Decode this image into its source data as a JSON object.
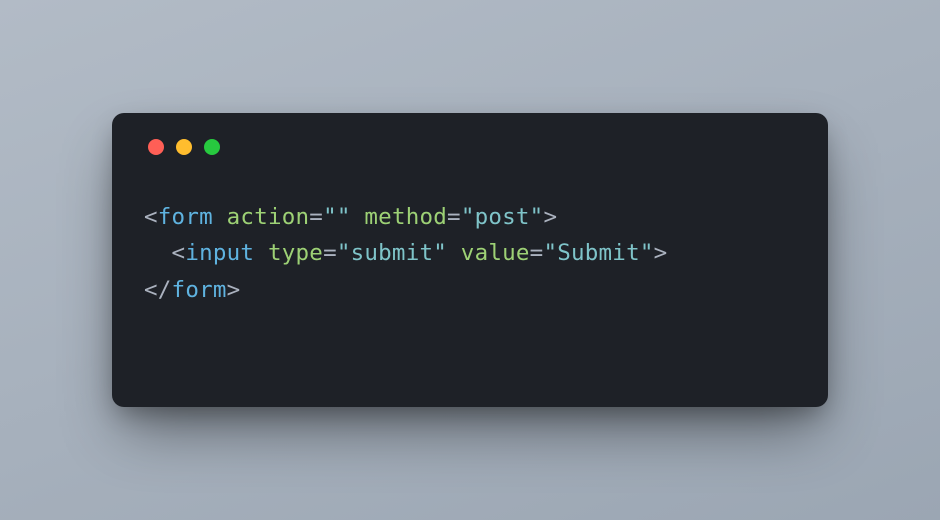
{
  "window": {
    "traffic_lights": {
      "red": "#ff5f56",
      "yellow": "#ffbd2e",
      "green": "#27c93f"
    }
  },
  "code": {
    "line1": {
      "open_angle": "<",
      "tag_form": "form",
      "space1": " ",
      "attr_action": "action",
      "eq1": "=",
      "val_action": "\"\"",
      "space2": " ",
      "attr_method": "method",
      "eq2": "=",
      "val_method": "\"post\"",
      "close_angle": ">"
    },
    "line2": {
      "indent": "  ",
      "open_angle": "<",
      "tag_input": "input",
      "space1": " ",
      "attr_type": "type",
      "eq1": "=",
      "val_type": "\"submit\"",
      "space2": " ",
      "attr_value": "value",
      "eq2": "=",
      "val_value": "\"Submit\"",
      "close_angle": ">"
    },
    "line3": {
      "open_close": "</",
      "tag_form": "form",
      "close_angle": ">"
    }
  },
  "colors": {
    "background": "#1e2127",
    "punct": "#abb2bf",
    "tag": "#5fb3e0",
    "attr": "#9dd175",
    "string": "#7fc4c9"
  }
}
